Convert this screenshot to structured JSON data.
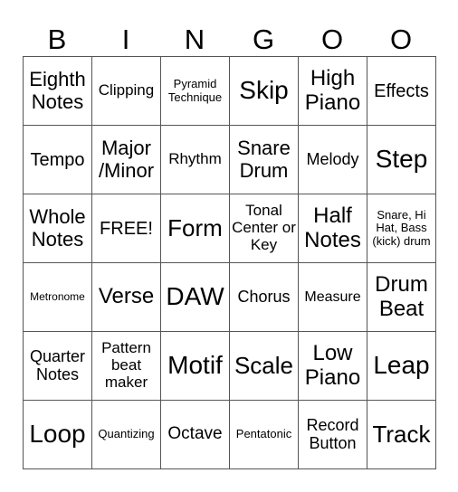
{
  "header": [
    "B",
    "I",
    "N",
    "G",
    "O",
    "O"
  ],
  "cells": [
    [
      "Eighth Notes",
      "Clipping",
      "Pyramid Technique",
      "Skip",
      "High Piano",
      "Effects"
    ],
    [
      "Tempo",
      "Major /Minor",
      "Rhythm",
      "Snare Drum",
      "Melody",
      "Step"
    ],
    [
      "Whole Notes",
      "FREE!",
      "Form",
      "Tonal Center or Key",
      "Half Notes",
      "Snare, Hi Hat, Bass (kick) drum"
    ],
    [
      "Metronome",
      "Verse",
      "DAW",
      "Chorus",
      "Measure",
      "Drum Beat"
    ],
    [
      "Quarter Notes",
      "Pattern beat maker",
      "Motif",
      "Scale",
      "Low Piano",
      "Leap"
    ],
    [
      "Loop",
      "Quantizing",
      "Octave",
      "Pentatonic",
      "Record Button",
      "Track"
    ]
  ]
}
